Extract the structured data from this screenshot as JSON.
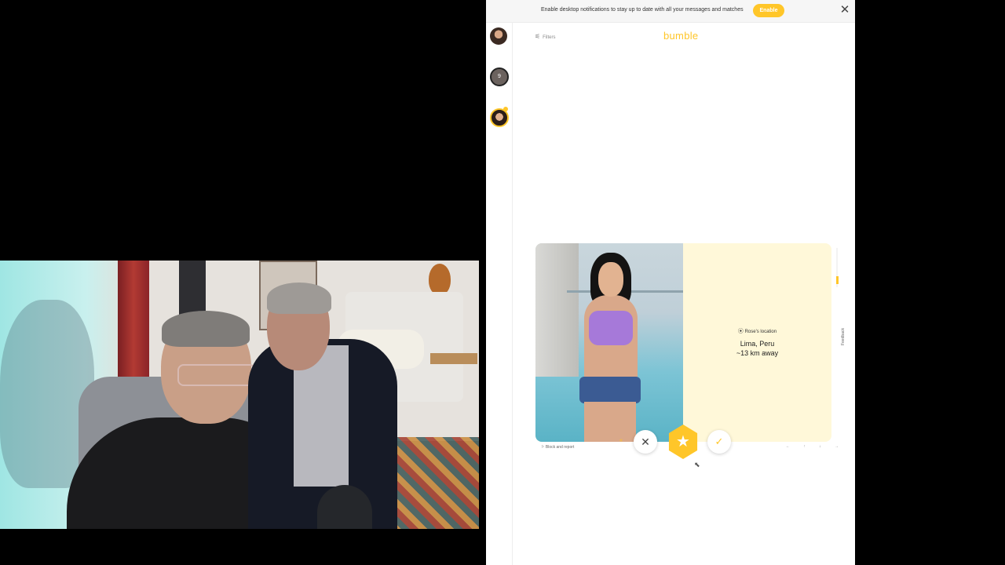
{
  "notification": {
    "text": "Enable desktop notifications to stay up to date with all your messages and matches",
    "enable_label": "Enable",
    "close_glyph": "✕"
  },
  "sidebar": {
    "items": [
      {
        "name": "profile-avatar"
      },
      {
        "name": "matches-avatar",
        "badge": "9"
      },
      {
        "name": "match-avatar"
      }
    ]
  },
  "header": {
    "filters_label": "Filters",
    "filters_icon": "sliders-icon",
    "logo": "bumble"
  },
  "profile_card": {
    "location_label": "Rose's location",
    "city": "Lima, Peru",
    "distance": "~13 km away"
  },
  "actions": {
    "block_report": "Block and report",
    "pass_glyph": "✕",
    "superswipe_glyph": "★",
    "like_glyph": "✓",
    "rewind_glyph": "«"
  },
  "feedback_label": "Feedback",
  "nav_keys": "← ↑ ↓ →",
  "colors": {
    "brand": "#ffc629",
    "card_bg": "#fff8d9"
  }
}
